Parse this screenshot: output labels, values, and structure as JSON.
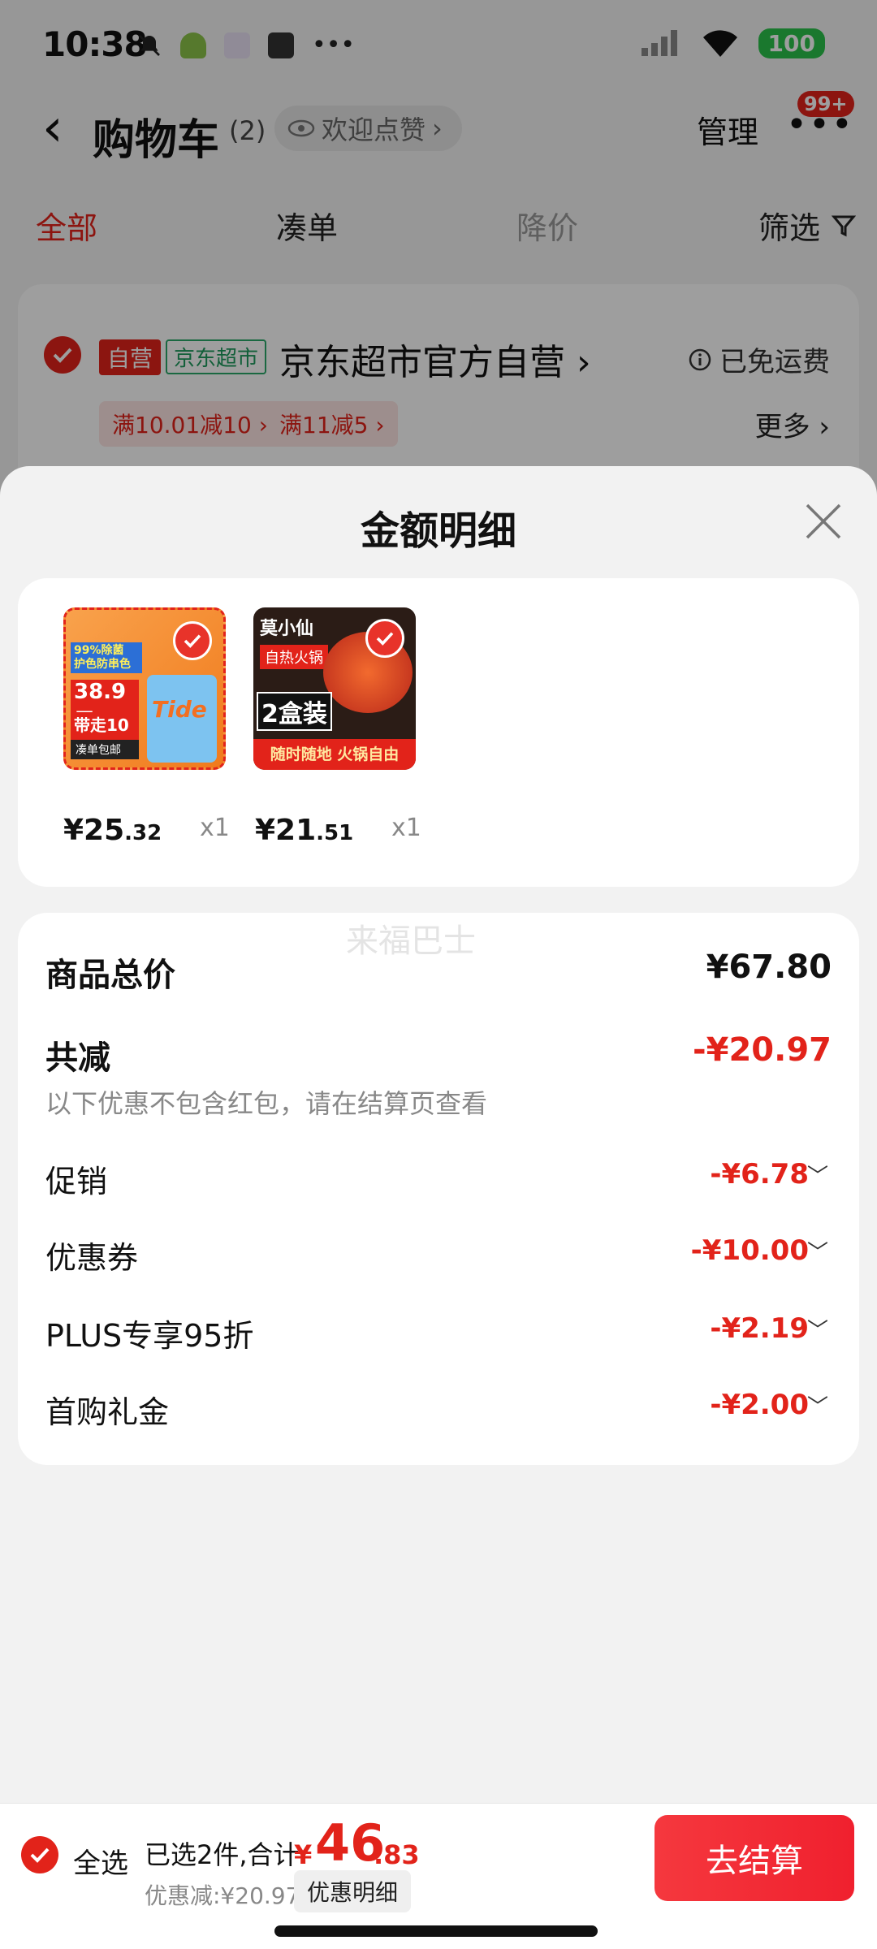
{
  "status_bar": {
    "time": "10:38",
    "battery": "100"
  },
  "header": {
    "back_icon": "chevron-left-icon",
    "title": "购物车",
    "count": "(2)",
    "welcome": "欢迎点赞",
    "manage": "管理",
    "more_badge": "99+"
  },
  "tabs": {
    "all": "全部",
    "combine": "凑单",
    "price_drop": "降价",
    "filter": "筛选"
  },
  "shop": {
    "tag_self": "自营",
    "tag_super": "京东超市",
    "name": "京东超市官方自营",
    "free_shipping": "已免运费",
    "promos": [
      "满10.01减10",
      "满11减5"
    ],
    "more": "更多"
  },
  "sheet": {
    "title": "金额明细",
    "products": [
      {
        "price_int": "¥25",
        "price_dec": ".32",
        "qty": "x1"
      },
      {
        "price_int": "¥21",
        "price_dec": ".51",
        "qty": "x1"
      }
    ],
    "product_1_image_text": {
      "l1": "99%除菌",
      "l2": "护色防串色",
      "price": "38.9元",
      "l3": "带走10斤",
      "l4": "凑单包邮",
      "brand": "Tide"
    },
    "product_2_image_text": {
      "brand": "莫小仙",
      "l1": "自热火锅",
      "l2": "2盒装",
      "l3": "随时随地 火锅自由"
    },
    "watermark": "来福巴士",
    "goods_total_label": "商品总价",
    "goods_total_value": "¥67.80",
    "reduce_label": "共减",
    "reduce_value": "-¥20.97",
    "note": "以下优惠不包含红包，请在结算页查看",
    "rows": [
      {
        "label": "促销",
        "value": "-¥6.78"
      },
      {
        "label": "优惠券",
        "value": "-¥10.00"
      },
      {
        "label": "PLUS专享95折",
        "value": "-¥2.19"
      },
      {
        "label": "首购礼金",
        "value": "-¥2.00"
      }
    ]
  },
  "bottom": {
    "select_all": "全选",
    "selected": "已选2件,合计:",
    "yen": "¥",
    "total_int": "46",
    "total_dec": ".83",
    "discount": "优惠减:¥20.97",
    "detail_btn": "优惠明细",
    "checkout": "去结算"
  },
  "colors": {
    "accent": "#e2231a",
    "green": "#2bc24b"
  }
}
